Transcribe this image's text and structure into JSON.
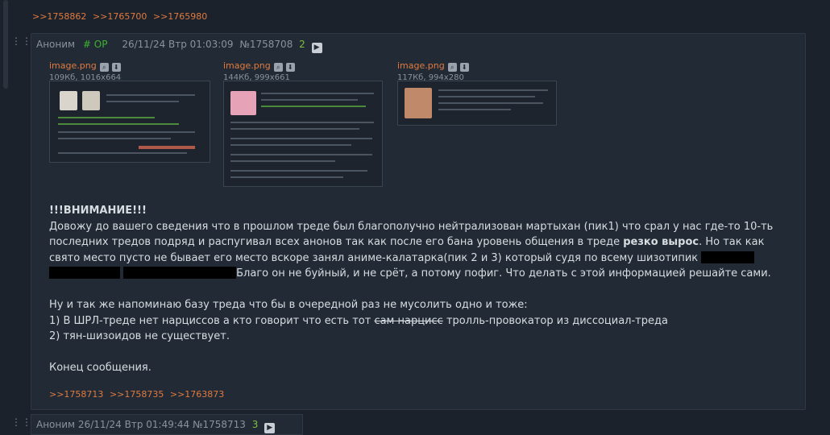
{
  "top_links": [
    ">>1758862",
    ">>1765700",
    ">>1765980"
  ],
  "dots": "⋮⋮",
  "post": {
    "author": "Аноним",
    "op_tag": "# OP",
    "date": "26/11/24 Втр 01:03:09",
    "number": "№1758708",
    "reply_count": "2",
    "files": [
      {
        "name": "image.png",
        "meta": "109Кб, 1016x664"
      },
      {
        "name": "image.png",
        "meta": "144Кб, 999x661"
      },
      {
        "name": "image.png",
        "meta": "117Кб, 994x280"
      }
    ],
    "body": {
      "heading": "!!!ВНИМАНИЕ!!!",
      "l1": "Довожу до вашего сведения что в прошлом треде был благополучно нейтрализован мартыхан (пик1) что срал у нас где-то 10-ть",
      "l2_pre": "последних тредов подряд и распугивал всех анонов так как после его бана уровень общения в треде ",
      "l2_bold": "резко вырос",
      "l2_post": ". Но так как",
      "l3": "свято место пусто не бывает его место вскоре занял аниме-калатарка(пик 2 и 3) который судя по всему шизотипик",
      "l4": "Благо он не буйный, и не срёт, а потому пофиг. Что делать с этой информацией решайте сами.",
      "l5": "Ну и так же напоминаю базу треда что бы в очередной раз не мусолить одно и тоже:",
      "l6_pre": "1) В ШРЛ-треде нет нарциссов а кто говорит что есть тот ",
      "l6_strike": "сам нарцисс",
      "l6_post": " тролль-провокатор из диссоциал-треда",
      "l7": "2) тян-шизоидов не существует.",
      "l8": "Конец сообщения."
    },
    "reply_links": [
      ">>1758713",
      ">>1758735",
      ">>1763873"
    ]
  },
  "post2": {
    "author": "Аноним",
    "date": "26/11/24 Втр 01:49:44",
    "number": "№1758713",
    "reply_count": "3"
  },
  "icons": {
    "play": "play-icon",
    "search": "search-icon",
    "download": "download-icon"
  }
}
